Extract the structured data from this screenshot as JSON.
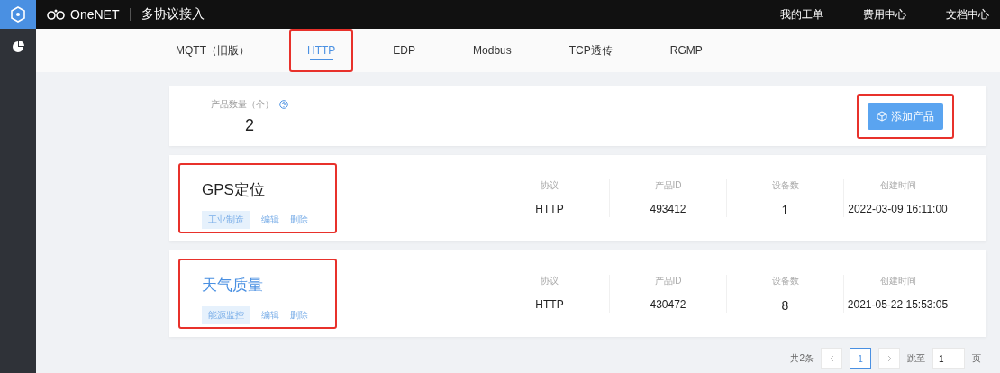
{
  "topbar": {
    "brand": "OneNET",
    "section": "多协议接入",
    "links": [
      "我的工单",
      "费用中心",
      "文档中心"
    ]
  },
  "tabs": [
    {
      "label": "MQTT（旧版）",
      "selected": false,
      "highlighted": false
    },
    {
      "label": "HTTP",
      "selected": true,
      "highlighted": true
    },
    {
      "label": "EDP",
      "selected": false,
      "highlighted": false
    },
    {
      "label": "Modbus",
      "selected": false,
      "highlighted": false
    },
    {
      "label": "TCP透传",
      "selected": false,
      "highlighted": false
    },
    {
      "label": "RGMP",
      "selected": false,
      "highlighted": false
    }
  ],
  "summary": {
    "label": "产品数量（个）",
    "count": "2",
    "add_button": {
      "label": "添加产品",
      "highlighted": true
    }
  },
  "products": [
    {
      "name": "GPS定位",
      "hovered": false,
      "highlighted": true,
      "tag": "工业制造",
      "actions": [
        "编辑",
        "删除"
      ],
      "fields": [
        {
          "label": "协议",
          "value": "HTTP"
        },
        {
          "label": "产品ID",
          "value": "493412"
        },
        {
          "label": "设备数",
          "value": "1"
        },
        {
          "label": "创建时间",
          "value": "2022-03-09 16:11:00"
        }
      ]
    },
    {
      "name": "天气质量",
      "hovered": true,
      "highlighted": true,
      "tag": "能源监控",
      "actions": [
        "编辑",
        "删除"
      ],
      "fields": [
        {
          "label": "协议",
          "value": "HTTP"
        },
        {
          "label": "产品ID",
          "value": "430472"
        },
        {
          "label": "设备数",
          "value": "8"
        },
        {
          "label": "创建时间",
          "value": "2021-05-22 15:53:05"
        }
      ]
    }
  ],
  "pagination": {
    "total": "共2条",
    "pages": [
      {
        "label": "1",
        "selected": true
      }
    ],
    "jump_label": "跳至",
    "jump_value": "1",
    "page_unit": "页"
  }
}
